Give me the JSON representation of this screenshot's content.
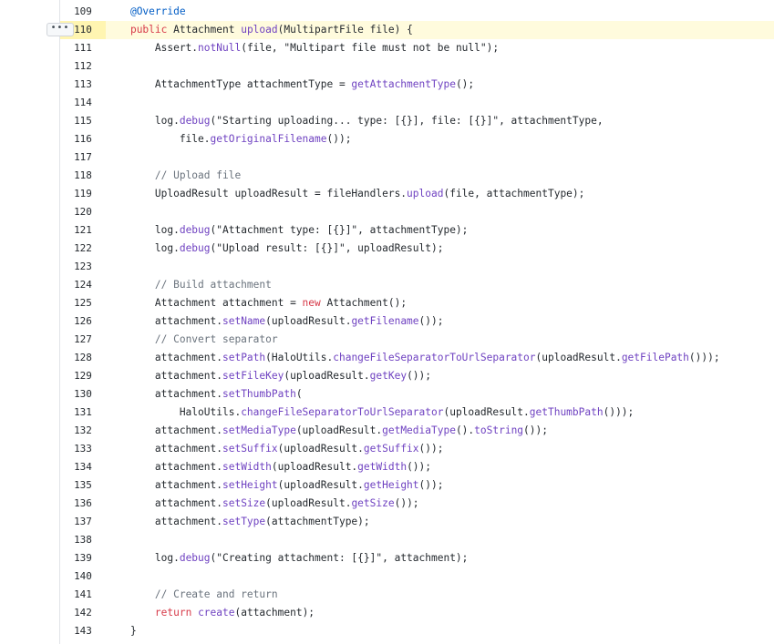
{
  "more_button": {
    "label": "•••"
  },
  "lines": [
    {
      "num": "109",
      "tokens": [
        {
          "t": "    "
        },
        {
          "c": "an",
          "t": "@Override"
        }
      ]
    },
    {
      "num": "110",
      "highlight": true,
      "tokens": [
        {
          "t": "    "
        },
        {
          "c": "kw",
          "t": "public"
        },
        {
          "t": " Attachment "
        },
        {
          "c": "fn",
          "t": "upload"
        },
        {
          "t": "(MultipartFile file) {"
        }
      ]
    },
    {
      "num": "111",
      "tokens": [
        {
          "t": "        Assert."
        },
        {
          "c": "fn",
          "t": "notNull"
        },
        {
          "t": "(file, \"Multipart file must not be null\");"
        }
      ]
    },
    {
      "num": "112",
      "tokens": [
        {
          "t": ""
        }
      ]
    },
    {
      "num": "113",
      "tokens": [
        {
          "t": "        AttachmentType attachmentType = "
        },
        {
          "c": "fn",
          "t": "getAttachmentType"
        },
        {
          "t": "();"
        }
      ]
    },
    {
      "num": "114",
      "tokens": [
        {
          "t": ""
        }
      ]
    },
    {
      "num": "115",
      "tokens": [
        {
          "t": "        log."
        },
        {
          "c": "fn",
          "t": "debug"
        },
        {
          "t": "(\"Starting uploading... type: [{}], file: [{}]\", attachmentType,"
        }
      ]
    },
    {
      "num": "116",
      "tokens": [
        {
          "t": "            file."
        },
        {
          "c": "fn",
          "t": "getOriginalFilename"
        },
        {
          "t": "());"
        }
      ]
    },
    {
      "num": "117",
      "tokens": [
        {
          "t": ""
        }
      ]
    },
    {
      "num": "118",
      "tokens": [
        {
          "t": "        "
        },
        {
          "c": "cm",
          "t": "// Upload file"
        }
      ]
    },
    {
      "num": "119",
      "tokens": [
        {
          "t": "        UploadResult uploadResult = fileHandlers."
        },
        {
          "c": "fn",
          "t": "upload"
        },
        {
          "t": "(file, attachmentType);"
        }
      ]
    },
    {
      "num": "120",
      "tokens": [
        {
          "t": ""
        }
      ]
    },
    {
      "num": "121",
      "tokens": [
        {
          "t": "        log."
        },
        {
          "c": "fn",
          "t": "debug"
        },
        {
          "t": "(\"Attachment type: [{}]\", attachmentType);"
        }
      ]
    },
    {
      "num": "122",
      "tokens": [
        {
          "t": "        log."
        },
        {
          "c": "fn",
          "t": "debug"
        },
        {
          "t": "(\"Upload result: [{}]\", uploadResult);"
        }
      ]
    },
    {
      "num": "123",
      "tokens": [
        {
          "t": ""
        }
      ]
    },
    {
      "num": "124",
      "tokens": [
        {
          "t": "        "
        },
        {
          "c": "cm",
          "t": "// Build attachment"
        }
      ]
    },
    {
      "num": "125",
      "tokens": [
        {
          "t": "        Attachment attachment = "
        },
        {
          "c": "kw",
          "t": "new"
        },
        {
          "t": " Attachment();"
        }
      ]
    },
    {
      "num": "126",
      "tokens": [
        {
          "t": "        attachment."
        },
        {
          "c": "fn",
          "t": "setName"
        },
        {
          "t": "(uploadResult."
        },
        {
          "c": "fn",
          "t": "getFilename"
        },
        {
          "t": "());"
        }
      ]
    },
    {
      "num": "127",
      "tokens": [
        {
          "t": "        "
        },
        {
          "c": "cm",
          "t": "// Convert separator"
        }
      ]
    },
    {
      "num": "128",
      "tokens": [
        {
          "t": "        attachment."
        },
        {
          "c": "fn",
          "t": "setPath"
        },
        {
          "t": "(HaloUtils."
        },
        {
          "c": "fn",
          "t": "changeFileSeparatorToUrlSeparator"
        },
        {
          "t": "(uploadResult."
        },
        {
          "c": "fn",
          "t": "getFilePath"
        },
        {
          "t": "()));"
        }
      ]
    },
    {
      "num": "129",
      "tokens": [
        {
          "t": "        attachment."
        },
        {
          "c": "fn",
          "t": "setFileKey"
        },
        {
          "t": "(uploadResult."
        },
        {
          "c": "fn",
          "t": "getKey"
        },
        {
          "t": "());"
        }
      ]
    },
    {
      "num": "130",
      "tokens": [
        {
          "t": "        attachment."
        },
        {
          "c": "fn",
          "t": "setThumbPath"
        },
        {
          "t": "("
        }
      ]
    },
    {
      "num": "131",
      "tokens": [
        {
          "t": "            HaloUtils."
        },
        {
          "c": "fn",
          "t": "changeFileSeparatorToUrlSeparator"
        },
        {
          "t": "(uploadResult."
        },
        {
          "c": "fn",
          "t": "getThumbPath"
        },
        {
          "t": "()));"
        }
      ]
    },
    {
      "num": "132",
      "tokens": [
        {
          "t": "        attachment."
        },
        {
          "c": "fn",
          "t": "setMediaType"
        },
        {
          "t": "(uploadResult."
        },
        {
          "c": "fn",
          "t": "getMediaType"
        },
        {
          "t": "()."
        },
        {
          "c": "fn",
          "t": "toString"
        },
        {
          "t": "());"
        }
      ]
    },
    {
      "num": "133",
      "tokens": [
        {
          "t": "        attachment."
        },
        {
          "c": "fn",
          "t": "setSuffix"
        },
        {
          "t": "(uploadResult."
        },
        {
          "c": "fn",
          "t": "getSuffix"
        },
        {
          "t": "());"
        }
      ]
    },
    {
      "num": "134",
      "tokens": [
        {
          "t": "        attachment."
        },
        {
          "c": "fn",
          "t": "setWidth"
        },
        {
          "t": "(uploadResult."
        },
        {
          "c": "fn",
          "t": "getWidth"
        },
        {
          "t": "());"
        }
      ]
    },
    {
      "num": "135",
      "tokens": [
        {
          "t": "        attachment."
        },
        {
          "c": "fn",
          "t": "setHeight"
        },
        {
          "t": "(uploadResult."
        },
        {
          "c": "fn",
          "t": "getHeight"
        },
        {
          "t": "());"
        }
      ]
    },
    {
      "num": "136",
      "tokens": [
        {
          "t": "        attachment."
        },
        {
          "c": "fn",
          "t": "setSize"
        },
        {
          "t": "(uploadResult."
        },
        {
          "c": "fn",
          "t": "getSize"
        },
        {
          "t": "());"
        }
      ]
    },
    {
      "num": "137",
      "tokens": [
        {
          "t": "        attachment."
        },
        {
          "c": "fn",
          "t": "setType"
        },
        {
          "t": "(attachmentType);"
        }
      ]
    },
    {
      "num": "138",
      "tokens": [
        {
          "t": ""
        }
      ]
    },
    {
      "num": "139",
      "tokens": [
        {
          "t": "        log."
        },
        {
          "c": "fn",
          "t": "debug"
        },
        {
          "t": "(\"Creating attachment: [{}]\", attachment);"
        }
      ]
    },
    {
      "num": "140",
      "tokens": [
        {
          "t": ""
        }
      ]
    },
    {
      "num": "141",
      "tokens": [
        {
          "t": "        "
        },
        {
          "c": "cm",
          "t": "// Create and return"
        }
      ]
    },
    {
      "num": "142",
      "tokens": [
        {
          "t": "        "
        },
        {
          "c": "kw",
          "t": "return"
        },
        {
          "t": " "
        },
        {
          "c": "fn",
          "t": "create"
        },
        {
          "t": "(attachment);"
        }
      ]
    },
    {
      "num": "143",
      "tokens": [
        {
          "t": "    }"
        }
      ]
    }
  ],
  "colors": {
    "keyword": "#d73a49",
    "function": "#6f42c1",
    "comment": "#6a737d",
    "annotation": "#005cc5",
    "highlight_line": "#fffbdd",
    "highlight_number": "#fff5b1"
  }
}
